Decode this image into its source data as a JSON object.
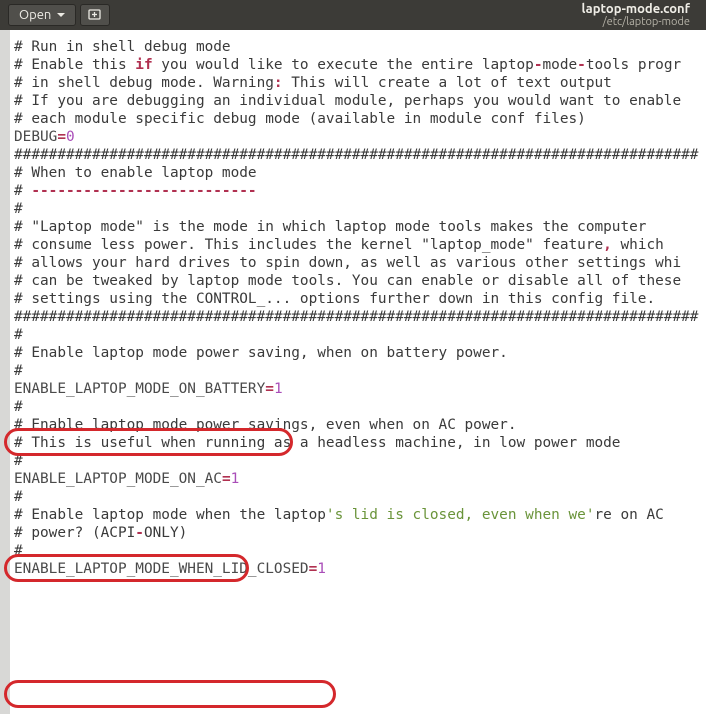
{
  "header": {
    "open_label": "Open",
    "filename": "laptop-mode.conf",
    "filepath": "/etc/laptop-mode"
  },
  "editor": {
    "lines": [
      [
        {
          "t": "# Run in shell debug mode",
          "c": "c-comment"
        }
      ],
      [
        {
          "t": "# Enable this ",
          "c": "c-comment"
        },
        {
          "t": "if",
          "c": "c-key"
        },
        {
          "t": " you would like to execute the entire laptop",
          "c": "c-comment"
        },
        {
          "t": "-",
          "c": "c-punc"
        },
        {
          "t": "mode",
          "c": "c-comment"
        },
        {
          "t": "-",
          "c": "c-punc"
        },
        {
          "t": "tools progr",
          "c": "c-comment"
        }
      ],
      [
        {
          "t": "# in shell debug mode. Warning",
          "c": "c-comment"
        },
        {
          "t": ":",
          "c": "c-punc"
        },
        {
          "t": " This will create a lot of text output",
          "c": "c-comment"
        }
      ],
      [
        {
          "t": "# If you are debugging an individual module, perhaps you would want to enable",
          "c": "c-comment"
        }
      ],
      [
        {
          "t": "# each module specific debug mode (available in module conf files)",
          "c": "c-comment"
        }
      ],
      [
        {
          "t": "DEBUG",
          "c": "c-op"
        },
        {
          "t": "=",
          "c": "c-punc"
        },
        {
          "t": "0",
          "c": "c-num"
        }
      ],
      [
        {
          "t": "",
          "c": ""
        }
      ],
      [
        {
          "t": "###############################################################################",
          "c": "c-comment"
        }
      ],
      [
        {
          "t": "# When to enable laptop mode",
          "c": "c-comment"
        }
      ],
      [
        {
          "t": "# ",
          "c": "c-comment"
        },
        {
          "t": "--------------------------",
          "c": "c-punc"
        }
      ],
      [
        {
          "t": "#",
          "c": "c-comment"
        }
      ],
      [
        {
          "t": "# \"Laptop mode\" is the mode in which laptop mode tools makes the computer",
          "c": "c-comment"
        }
      ],
      [
        {
          "t": "# consume less power. This includes the kernel \"laptop_mode\" feature",
          "c": "c-comment"
        },
        {
          "t": ",",
          "c": "c-punc"
        },
        {
          "t": " which",
          "c": "c-comment"
        }
      ],
      [
        {
          "t": "# allows your hard drives to spin down, as well as various other settings whi",
          "c": "c-comment"
        }
      ],
      [
        {
          "t": "# can be tweaked by laptop mode tools. You can enable or disable all of these",
          "c": "c-comment"
        }
      ],
      [
        {
          "t": "# settings using the CONTROL_... options further down in this config file.",
          "c": "c-comment"
        }
      ],
      [
        {
          "t": "###############################################################################",
          "c": "c-comment"
        }
      ],
      [
        {
          "t": "",
          "c": ""
        }
      ],
      [
        {
          "t": "",
          "c": ""
        }
      ],
      [
        {
          "t": "#",
          "c": "c-comment"
        }
      ],
      [
        {
          "t": "# Enable laptop mode power saving, when on battery power.",
          "c": "c-comment"
        }
      ],
      [
        {
          "t": "#",
          "c": "c-comment"
        }
      ],
      [
        {
          "t": "ENABLE_LAPTOP_MODE_ON_BATTERY",
          "c": "c-op"
        },
        {
          "t": "=",
          "c": "c-punc"
        },
        {
          "t": "1",
          "c": "c-num"
        }
      ],
      [
        {
          "t": "",
          "c": ""
        }
      ],
      [
        {
          "t": "",
          "c": ""
        }
      ],
      [
        {
          "t": "#",
          "c": "c-comment"
        }
      ],
      [
        {
          "t": "# Enable laptop mode power savings, even when on AC power.",
          "c": "c-comment"
        }
      ],
      [
        {
          "t": "# This is useful when running as a headless machine, in low power mode",
          "c": "c-comment"
        }
      ],
      [
        {
          "t": "#",
          "c": "c-comment"
        }
      ],
      [
        {
          "t": "ENABLE_LAPTOP_MODE_ON_AC",
          "c": "c-op"
        },
        {
          "t": "=",
          "c": "c-punc"
        },
        {
          "t": "1",
          "c": "c-num"
        }
      ],
      [
        {
          "t": "",
          "c": ""
        }
      ],
      [
        {
          "t": "",
          "c": ""
        }
      ],
      [
        {
          "t": "#",
          "c": "c-comment"
        }
      ],
      [
        {
          "t": "# Enable laptop mode when the laptop",
          "c": "c-comment"
        },
        {
          "t": "'s lid is closed, even when we'",
          "c": "c-str"
        },
        {
          "t": "re on AC",
          "c": "c-comment"
        }
      ],
      [
        {
          "t": "# power? (ACPI",
          "c": "c-comment"
        },
        {
          "t": "-",
          "c": "c-punc"
        },
        {
          "t": "ONLY)",
          "c": "c-comment"
        }
      ],
      [
        {
          "t": "#",
          "c": "c-comment"
        }
      ],
      [
        {
          "t": "ENABLE_LAPTOP_MODE_WHEN_LID_CLOSED",
          "c": "c-op"
        },
        {
          "t": "=",
          "c": "c-punc"
        },
        {
          "t": "1",
          "c": "c-num"
        }
      ]
    ],
    "highlights": [
      {
        "line": 22,
        "key": "ENABLE_LAPTOP_MODE_ON_BATTERY",
        "value": "1"
      },
      {
        "line": 29,
        "key": "ENABLE_LAPTOP_MODE_ON_AC",
        "value": "1"
      },
      {
        "line": 36,
        "key": "ENABLE_LAPTOP_MODE_WHEN_LID_CLOSED",
        "value": "1"
      }
    ]
  }
}
